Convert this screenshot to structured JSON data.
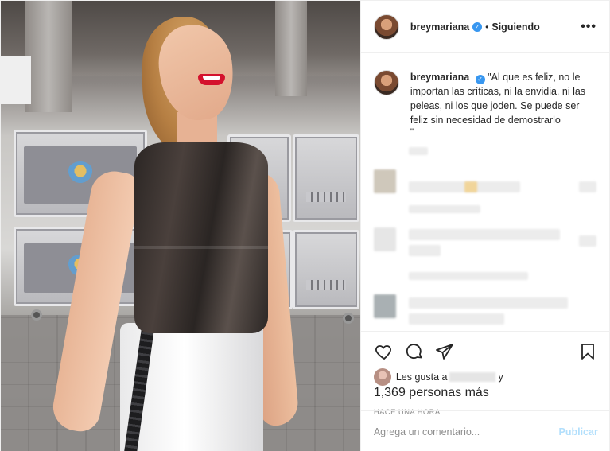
{
  "header": {
    "username": "breymariana",
    "separator": "•",
    "follow_status": "Siguiendo",
    "more": "•••"
  },
  "caption": {
    "username": "breymariana",
    "text": "\"Al que es feliz, no le importan las críticas, ni la envidia, ni las peleas, ni los que joden. Se puede ser feliz sin necesidad de demostrarlo",
    "tail": "\""
  },
  "likes": {
    "prefix": "Les gusta a",
    "suffix": "y",
    "count_line": "1,369 personas más"
  },
  "timestamp": "HACE UNA HORA",
  "add_comment": {
    "placeholder": "Agrega un comentario...",
    "post_label": "Publicar"
  },
  "icons": [
    "heart-icon",
    "comment-icon",
    "share-icon",
    "bookmark-icon",
    "verified-icon"
  ],
  "colors": {
    "verified": "#3897f0",
    "post_disabled": "#b2dffc",
    "muted_text": "#8e8e8e",
    "lipstick": "#d4122d"
  }
}
